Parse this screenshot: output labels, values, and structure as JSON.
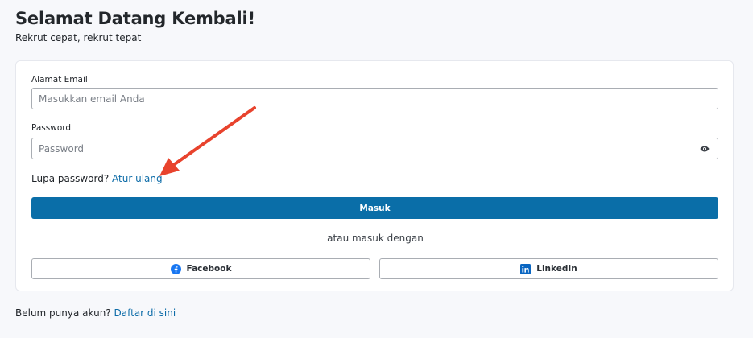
{
  "header": {
    "title": "Selamat Datang Kembali!",
    "subtitle": "Rekrut cepat, rekrut tepat"
  },
  "form": {
    "email_label": "Alamat Email",
    "email_placeholder": "Masukkan email Anda",
    "email_value": "",
    "password_label": "Password",
    "password_placeholder": "Password",
    "password_value": "",
    "password_toggle_icon": "eye-icon",
    "forgot_text": "Lupa password?",
    "forgot_link": "Atur ulang",
    "submit_label": "Masuk",
    "alt_text": "atau masuk dengan"
  },
  "social": [
    {
      "label": "Facebook",
      "icon": "facebook-icon",
      "color": "#1877f2"
    },
    {
      "label": "LinkedIn",
      "icon": "linkedin-icon",
      "color": "#0a66c2"
    }
  ],
  "footer": {
    "signup_text": "Belum punya akun?",
    "signup_link": "Daftar di sini"
  },
  "annotation": {
    "arrow_color": "#e8432d",
    "arrow_target": "forgot-password-link"
  },
  "colors": {
    "primary": "#0a6ea8",
    "link": "#0d6ca8",
    "background": "#f7f8fb"
  }
}
